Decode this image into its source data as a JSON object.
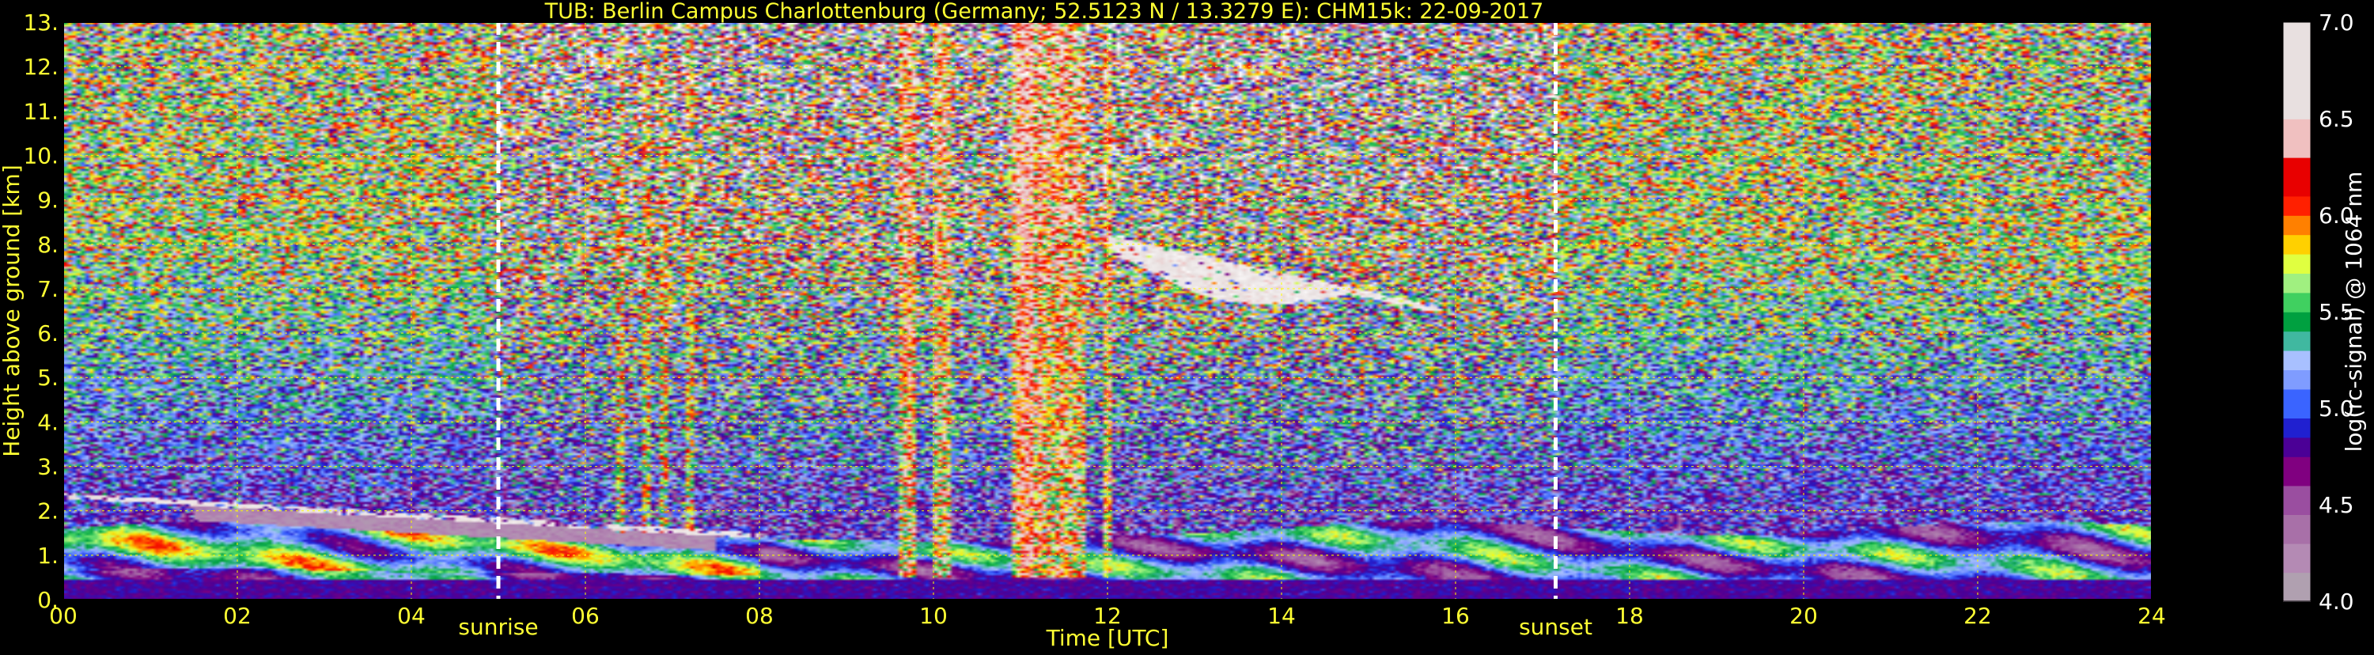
{
  "chart_data": {
    "type": "heatmap",
    "title": "TUB: Berlin Campus Charlottenburg (Germany; 52.5123 N / 13.3279 E):    CHM15k: 22-09-2017",
    "xlabel": "Time [UTC]",
    "ylabel": "Height above ground [km]",
    "xlim": [
      0,
      24
    ],
    "ylim": [
      0,
      13
    ],
    "x_ticks": [
      "00",
      "02",
      "04",
      "06",
      "08",
      "10",
      "12",
      "14",
      "16",
      "18",
      "20",
      "22",
      "24"
    ],
    "y_ticks": [
      "0.",
      "1.",
      "2.",
      "3.",
      "4.",
      "5.",
      "6.",
      "7.",
      "8.",
      "9.",
      "10.",
      "11.",
      "12.",
      "13."
    ],
    "grid": true,
    "annotations": [
      {
        "text": "sunrise",
        "x": 5.0
      },
      {
        "text": "sunset",
        "x": 17.15
      }
    ],
    "colorbar": {
      "label": "log(rc-signal) @ 1064 nm",
      "range": [
        4.0,
        7.0
      ],
      "ticks": [
        "4.0",
        "4.5",
        "5.0",
        "5.5",
        "6.0",
        "6.5",
        "7.0"
      ],
      "levels": [
        {
          "v": 4.0,
          "color": "#b0a0b0"
        },
        {
          "v": 4.15,
          "color": "#b48ab4"
        },
        {
          "v": 4.3,
          "color": "#a870a8"
        },
        {
          "v": 4.45,
          "color": "#9a4ea0"
        },
        {
          "v": 4.6,
          "color": "#800080"
        },
        {
          "v": 4.75,
          "color": "#4b0096"
        },
        {
          "v": 4.85,
          "color": "#2020d0"
        },
        {
          "v": 4.95,
          "color": "#3a64ff"
        },
        {
          "v": 5.1,
          "color": "#7f9cff"
        },
        {
          "v": 5.2,
          "color": "#a8c0ff"
        },
        {
          "v": 5.3,
          "color": "#40b8a0"
        },
        {
          "v": 5.4,
          "color": "#00a040"
        },
        {
          "v": 5.5,
          "color": "#40d060"
        },
        {
          "v": 5.6,
          "color": "#a0f080"
        },
        {
          "v": 5.7,
          "color": "#e0ff40"
        },
        {
          "v": 5.8,
          "color": "#ffd000"
        },
        {
          "v": 5.9,
          "color": "#ff8000"
        },
        {
          "v": 6.0,
          "color": "#ff2000"
        },
        {
          "v": 6.1,
          "color": "#e80000"
        },
        {
          "v": 6.3,
          "color": "#f0c0c0"
        },
        {
          "v": 6.5,
          "color": "#e8e0e0"
        },
        {
          "v": 7.0,
          "color": "#ffffff"
        }
      ]
    },
    "features": [
      {
        "name": "boundary layer",
        "x": [
          0,
          24
        ],
        "height_km": [
          0.0,
          1.6
        ],
        "value": 5.3
      },
      {
        "name": "low cloud",
        "x": [
          0,
          8
        ],
        "height_km": [
          1.3,
          2.4
        ],
        "value": 6.6
      },
      {
        "name": "cirrus",
        "x": [
          12.0,
          15.8
        ],
        "height_km": [
          6.3,
          8.2
        ],
        "value": 6.6
      },
      {
        "name": "precipitation streaks",
        "x": [
          9.2,
          12.0
        ],
        "height_km": [
          0.5,
          13.0
        ],
        "value": 5.0
      }
    ],
    "sunrise": 5.0,
    "sunset": 17.15
  },
  "colors": {
    "text": "#ffff33",
    "grid": "#ffff00",
    "sunline": "#ffffff",
    "background": "#000000"
  }
}
